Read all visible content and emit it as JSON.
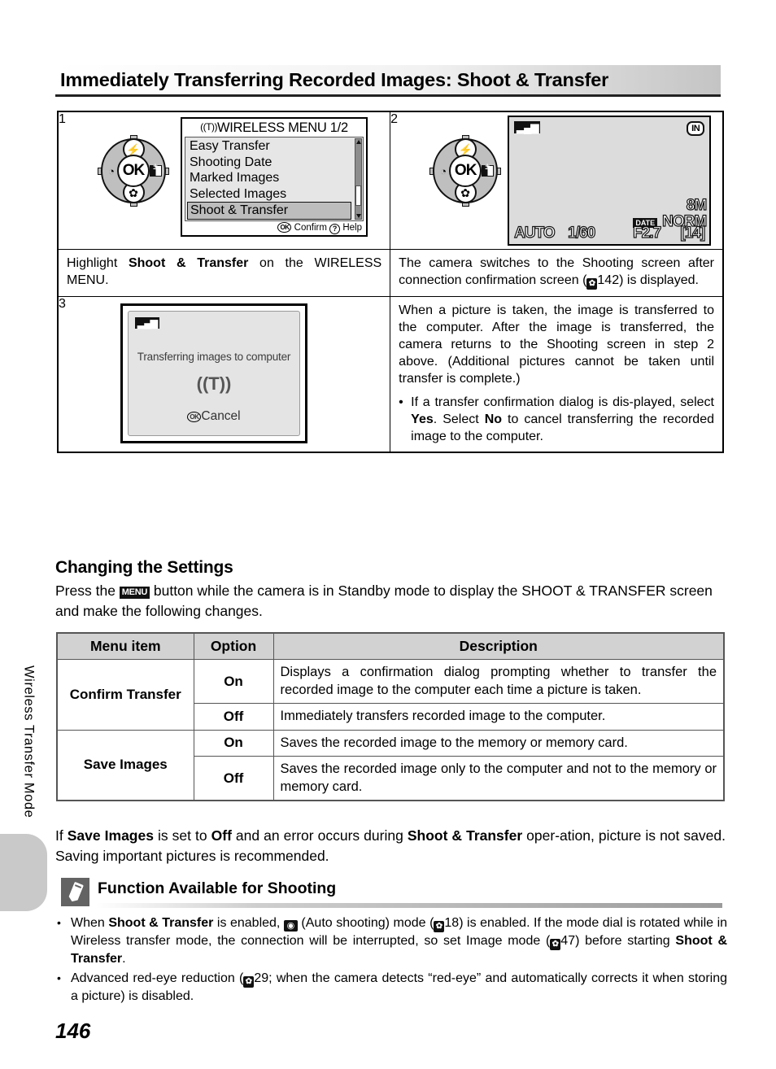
{
  "sidebar": {
    "label": "Wireless Transfer Mode"
  },
  "header": {
    "title": "Immediately Transferring Recorded Images: Shoot & Transfer"
  },
  "steps": [
    {
      "number": "1",
      "lcd": {
        "title": "WIRELESS MENU 1/2",
        "wireless_badge": "((T))",
        "items": [
          "Easy Transfer",
          "Shooting Date",
          "Marked Images",
          "Selected Images",
          "Shoot & Transfer"
        ],
        "selected_item": "Shoot & Transfer",
        "footer_confirm": "Confirm",
        "footer_help": "Help",
        "ok_glyph": "OK",
        "help_glyph": "?"
      },
      "caption_pre": "Highlight ",
      "caption_bold": "Shoot & Transfer",
      "caption_post": " on the WIRELESS MENU."
    },
    {
      "number": "2",
      "lcd": {
        "signal_icon": "signal-bars",
        "memory_icon": "IN",
        "image_size": "8M",
        "quality": "NORM",
        "date_icon": "DATE",
        "mode": "AUTO",
        "shutter": "1/60",
        "aperture": "F2.7",
        "shots_remaining": "14"
      },
      "caption": "The camera switches to the Shooting screen after connection confirmation screen (",
      "caption_ref": "142",
      "caption_end": ") is displayed."
    },
    {
      "number": "3",
      "lcd": {
        "signal_icon": "signal-bars",
        "message": "Transferring images to computer",
        "antenna_icon": "((T))",
        "cancel_label": "Cancel",
        "ok_glyph": "OK"
      },
      "paragraph": "When a picture is taken, the image is transferred to the computer. After the image is transferred, the camera returns to the Shooting screen in step 2 above. (Additional pictures cannot be taken until transfer is complete.)",
      "bullet": {
        "p1": "If a transfer confirmation dialog is dis-played, select ",
        "yes": "Yes",
        "p2": ". Select ",
        "no": "No",
        "p3": " to cancel transferring the recorded image to the computer."
      }
    }
  ],
  "settings": {
    "heading": "Changing the Settings",
    "intro_1": "Press the ",
    "menu_glyph": "MENU",
    "intro_2": " button while the camera is in Standby mode to display the SHOOT & TRANSFER screen and make the following changes.",
    "table": {
      "headers": [
        "Menu item",
        "Option",
        "Description"
      ],
      "rows": [
        {
          "menu_item": "Confirm Transfer",
          "options": [
            {
              "option": "On",
              "description": "Displays a confirmation dialog prompting whether to transfer the recorded image to the computer each time a picture is taken."
            },
            {
              "option": "Off",
              "description": "Immediately transfers recorded image to the computer."
            }
          ]
        },
        {
          "menu_item": "Save Images",
          "options": [
            {
              "option": "On",
              "description": "Saves the recorded image to the memory or memory card."
            },
            {
              "option": "Off",
              "description": "Saves the recorded image only to the computer and not to the memory or memory card."
            }
          ]
        }
      ]
    },
    "after_table": {
      "p1": "If ",
      "b1": "Save Images",
      "p2": " is set to ",
      "b2": "Off",
      "p3": " and an error occurs during ",
      "b3": "Shoot & Transfer",
      "p4": " oper-ation, picture is not saved. Saving important pictures is recommended."
    }
  },
  "note": {
    "icon": "pencil-icon",
    "title": "Function Available for Shooting",
    "bullets": [
      {
        "p1": "When ",
        "b1": "Shoot & Transfer",
        "p2": " is enabled, ",
        "icon": "auto-shooting-icon",
        "p3": " (Auto shooting) mode (",
        "ref1": "18",
        "p4": ") is enabled. If the mode dial is rotated while in Wireless transfer mode, the connection will be interrupted, so set Image mode (",
        "ref2": "47",
        "p5": ") before starting ",
        "b2": "Shoot & Transfer",
        "p6": "."
      },
      {
        "p1": "Advanced red-eye reduction (",
        "ref1": "29",
        "p2": "; when the camera detects “red-eye” and automatically corrects it when storing a picture) is disabled."
      }
    ]
  },
  "page_number": "146"
}
